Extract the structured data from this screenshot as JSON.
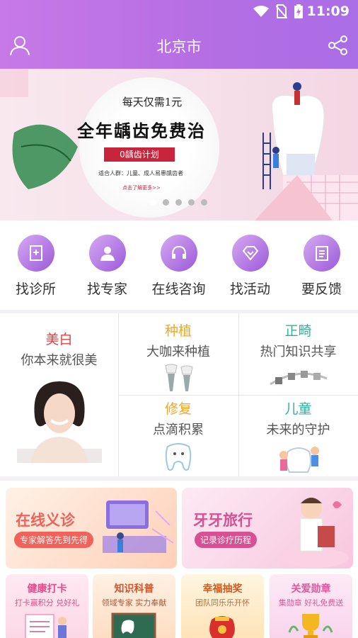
{
  "status_bar": {
    "time": "11:09"
  },
  "header": {
    "title": "北京市"
  },
  "banner": {
    "line1": "每天仅需1元",
    "headline": "全年龋齿免费治",
    "plan": "0龋齿计划",
    "note": "适合人群：儿童、成人易患龋齿者",
    "cta": "点击了解更多>>"
  },
  "quick_menu": {
    "items": [
      {
        "label": "找诊所",
        "icon": "clinic-icon"
      },
      {
        "label": "找专家",
        "icon": "doctor-icon"
      },
      {
        "label": "在线咨询",
        "icon": "headset-icon"
      },
      {
        "label": "找活动",
        "icon": "diamond-icon"
      },
      {
        "label": "要反馈",
        "icon": "clipboard-icon"
      }
    ]
  },
  "services": {
    "whitening": {
      "title": "美白",
      "subtitle": "你本来就很美",
      "color": "#e6403f"
    },
    "implant": {
      "title": "种植",
      "subtitle": "大咖来种植",
      "color": "#f5a623"
    },
    "ortho": {
      "title": "正畸",
      "subtitle": "热门知识共享",
      "color": "#2db39c"
    },
    "repair": {
      "title": "修复",
      "subtitle": "点滴积累",
      "color": "#f5a623"
    },
    "children": {
      "title": "儿童",
      "subtitle": "未来的守护",
      "color": "#2db39c"
    }
  },
  "promos": {
    "online": {
      "title": "在线义诊",
      "tag": "专家解答先到先得"
    },
    "travel": {
      "title": "牙牙旅行",
      "tag": "记录诊疗历程"
    },
    "checkin": {
      "title": "健康打卡",
      "subtitle": "打卡赢积分 兑好礼"
    },
    "knowledge": {
      "title": "知识科普",
      "subtitle": "领域专家 实力奉献"
    },
    "lottery": {
      "title": "幸福抽奖",
      "subtitle": "团队同乐乐开怀"
    },
    "medal": {
      "title": "关爱勋章",
      "subtitle": "集勋章 好礼免费送"
    }
  }
}
